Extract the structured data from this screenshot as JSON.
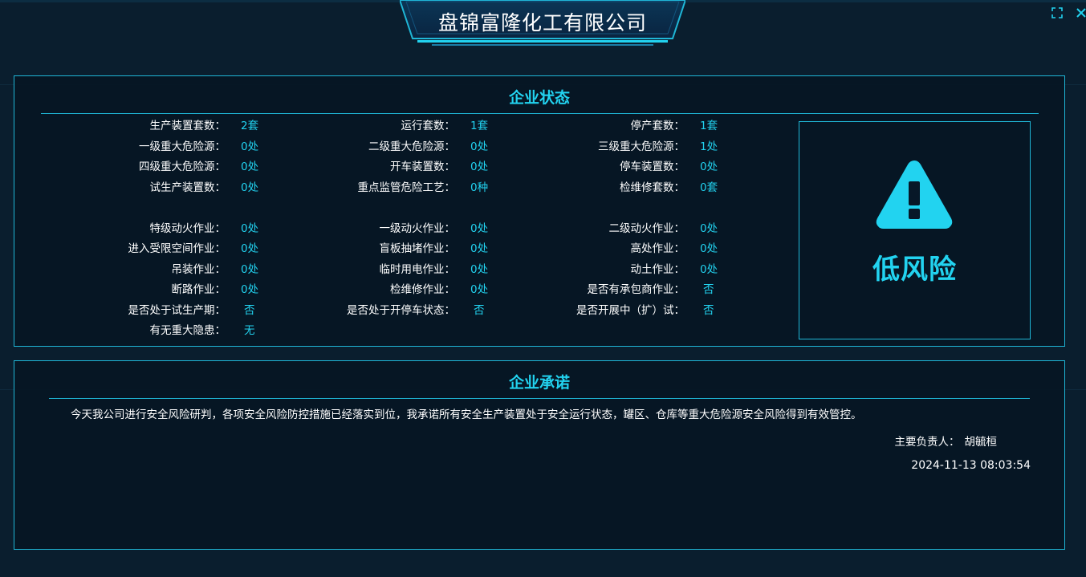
{
  "header": {
    "company_name": "盘锦富隆化工有限公司",
    "fullscreen_icon": "expand-icon",
    "close_icon": "close-icon"
  },
  "status_panel": {
    "title": "企业状态",
    "rows": [
      [
        {
          "label": "生产装置套数：",
          "value": "2套"
        },
        {
          "label": "运行套数：",
          "value": "1套"
        },
        {
          "label": "停产套数：",
          "value": "1套"
        }
      ],
      [
        {
          "label": "一级重大危险源：",
          "value": "0处"
        },
        {
          "label": "二级重大危险源：",
          "value": "0处"
        },
        {
          "label": "三级重大危险源：",
          "value": "1处"
        }
      ],
      [
        {
          "label": "四级重大危险源：",
          "value": "0处"
        },
        {
          "label": "开车装置数：",
          "value": "0处"
        },
        {
          "label": "停车装置数：",
          "value": "0处"
        }
      ],
      [
        {
          "label": "试生产装置数：",
          "value": "0处"
        },
        {
          "label": "重点监管危险工艺：",
          "value": "0种"
        },
        {
          "label": "检维修套数：",
          "value": "0套"
        }
      ],
      [
        {
          "label": "特级动火作业：",
          "value": "0处"
        },
        {
          "label": "一级动火作业：",
          "value": "0处"
        },
        {
          "label": "二级动火作业：",
          "value": "0处"
        }
      ],
      [
        {
          "label": "进入受限空间作业：",
          "value": "0处"
        },
        {
          "label": "盲板抽堵作业：",
          "value": "0处"
        },
        {
          "label": "高处作业：",
          "value": "0处"
        }
      ],
      [
        {
          "label": "吊装作业：",
          "value": "0处"
        },
        {
          "label": "临时用电作业：",
          "value": "0处"
        },
        {
          "label": "动土作业：",
          "value": "0处"
        }
      ],
      [
        {
          "label": "断路作业：",
          "value": "0处"
        },
        {
          "label": "检维修作业：",
          "value": "0处"
        },
        {
          "label": "是否有承包商作业：",
          "value": "否"
        }
      ],
      [
        {
          "label": "是否处于试生产期：",
          "value": "否"
        },
        {
          "label": "是否处于开停车状态：",
          "value": "否"
        },
        {
          "label": "是否开展中（扩）试：",
          "value": "否"
        }
      ],
      [
        {
          "label": "有无重大隐患：",
          "value": "无"
        }
      ]
    ],
    "risk": {
      "icon": "warning-triangle-icon",
      "level_text": "低风险",
      "color": "#22d3f0"
    }
  },
  "commitment_panel": {
    "title": "企业承诺",
    "text": "今天我公司进行安全风险研判，各项安全风险防控措施已经落实到位，我承诺所有安全生产装置处于安全运行状态，罐区、仓库等重大危险源安全风险得到有效管控。",
    "signer_label": "主要负责人：",
    "signer_name": "胡毓桓",
    "timestamp": "2024-11-13 08:03:54"
  },
  "colors": {
    "accent": "#22d3f0",
    "border": "#1fb6d6",
    "background": "#071828"
  }
}
